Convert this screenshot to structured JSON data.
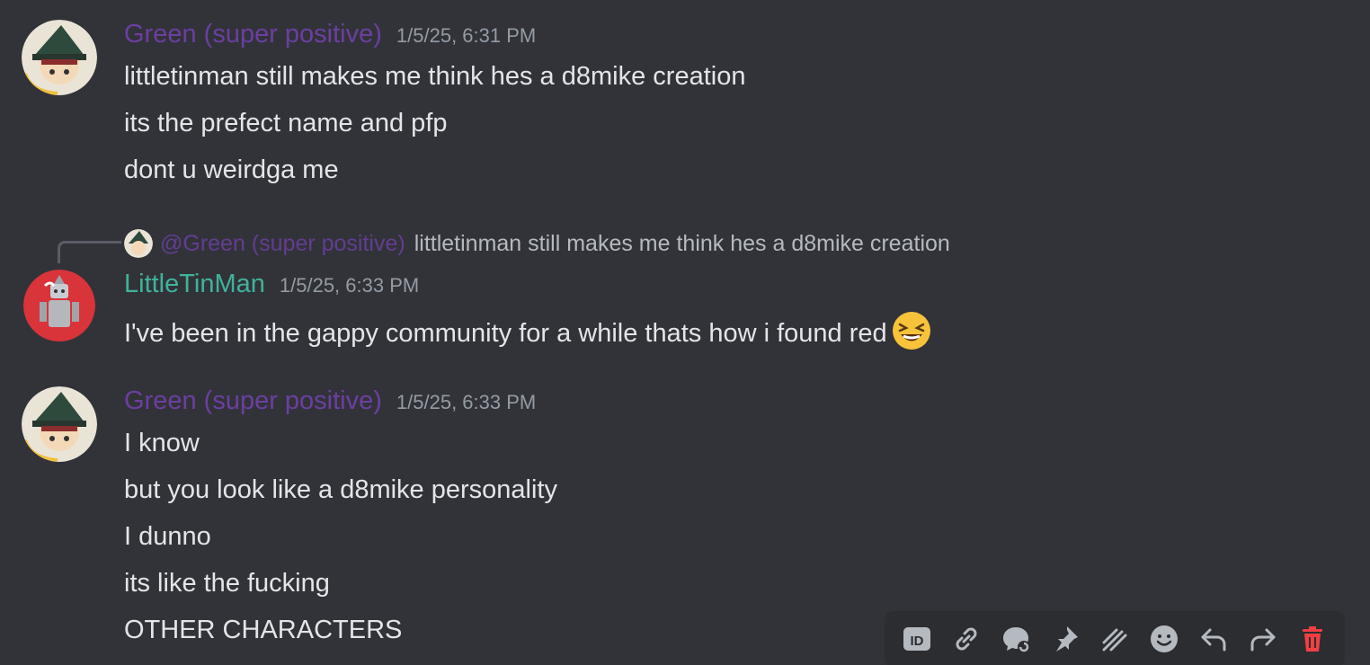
{
  "messages": [
    {
      "author": "Green (super positive)",
      "timestamp": "1/5/25, 6:31 PM",
      "lines": [
        "littletinman still makes me think hes a d8mike creation",
        "its the prefect name and pfp",
        "dont u weirdga me"
      ]
    },
    {
      "reply": {
        "author": "@Green (super positive)",
        "text": "littletinman still makes me think hes a d8mike creation"
      },
      "author": "LittleTinMan",
      "timestamp": "1/5/25, 6:33 PM",
      "lines": [
        "I've been in the gappy community for a while thats how i found red"
      ],
      "emoji": "laughing-squint-emoji"
    },
    {
      "author": "Green (super positive)",
      "timestamp": "1/5/25, 6:33 PM",
      "lines": [
        "I know",
        "but you look like a d8mike personality",
        "I dunno",
        "its like the fucking",
        "OTHER CHARACTERS"
      ]
    }
  ],
  "toolbar": {
    "icons": [
      "id-icon",
      "link-icon",
      "thread-icon",
      "pin-icon",
      "mark-unread-icon",
      "reaction-icon",
      "reply-icon",
      "forward-icon",
      "delete-icon"
    ]
  },
  "colors": {
    "background": "#323339",
    "green_user": "#6b3fa0",
    "tin_user": "#3fb39a",
    "delete": "#f23f42"
  }
}
